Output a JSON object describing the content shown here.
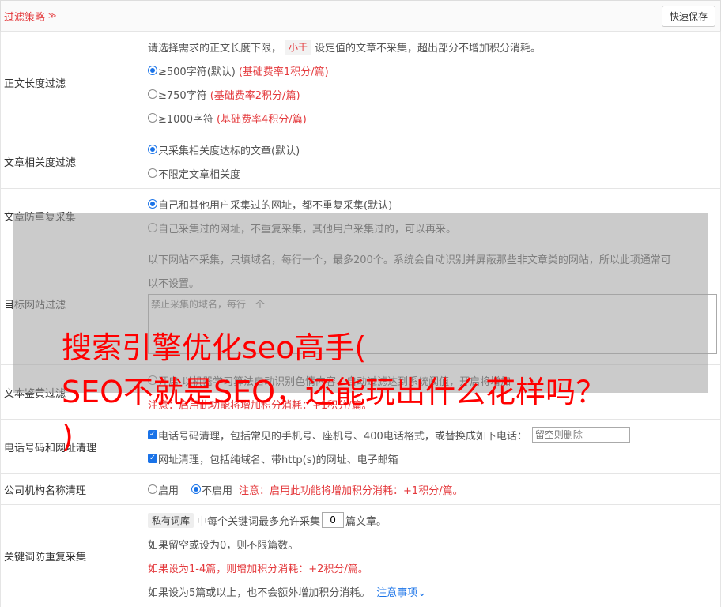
{
  "header": {
    "title": "过滤策略",
    "save_label": "快速保存"
  },
  "length_filter": {
    "label": "正文长度过滤",
    "intro_a": "请选择需求的正文长度下限，",
    "intro_tag": "小于",
    "intro_b": "设定值的文章不采集，超出部分不增加积分消耗。",
    "options": [
      {
        "text": "≥500字符(默认)",
        "note": "(基础费率1积分/篇)"
      },
      {
        "text": "≥750字符",
        "note": "(基础费率2积分/篇)"
      },
      {
        "text": "≥1000字符",
        "note": "(基础费率4积分/篇)"
      }
    ]
  },
  "relevance": {
    "label": "文章相关度过滤",
    "options": [
      "只采集相关度达标的文章(默认)",
      "不限定文章相关度"
    ]
  },
  "dedupe": {
    "label": "文章防重复采集",
    "options": [
      "自己和其他用户采集过的网址，都不重复采集(默认)",
      "自己采集过的网址，不重复采集，其他用户采集过的，可以再采。"
    ]
  },
  "site_filter": {
    "label": "目标网站过滤",
    "intro_1": "以下网站不采集，只填域名，每行一个，最多200个。系统会自动识别并屏蔽那些非文章类的网站，所以此项通常可",
    "intro_2": "以不设置。",
    "placeholder": "禁止采集的域名，每行一个"
  },
  "porn": {
    "label": "文本鉴黄过滤",
    "line_1": "开启 以机器学习算法自动识别色情内容，自动过滤达到系统阈值，开启将增加",
    "warn": "注意：启用此功能将增加积分消耗：+1积分/篇。"
  },
  "cleanup": {
    "label": "电话号码和网址清理",
    "phone": "电话号码清理，包括常见的手机号、座机号、400电话格式，或替换成如下电话：",
    "phone_placeholder": "留空则删除",
    "url": "网址清理，包括纯域名、带http(s)的网址、电子邮箱"
  },
  "org": {
    "label": "公司机构名称清理",
    "on": "启用",
    "off": "不启用",
    "warn": "注意：启用此功能将增加积分消耗：+1积分/篇。"
  },
  "keyword": {
    "label": "关键词防重复采集",
    "tag": "私有词库",
    "l1_a": "中每个关键词最多允许采集",
    "value": "0",
    "l1_b": "篇文章。",
    "l2": "如果留空或设为0，则不限篇数。",
    "l3": "如果设为1-4篇，则增加积分消耗：+2积分/篇。",
    "l4": "如果设为5篇或以上，也不会额外增加积分消耗。",
    "notes": "注意事项"
  },
  "overlay": {
    "line_1": "搜索引擎优化seo高手(",
    "line_2": "SEO不就是SEO，还能玩出什么花样吗？",
    "line_3": ")"
  }
}
